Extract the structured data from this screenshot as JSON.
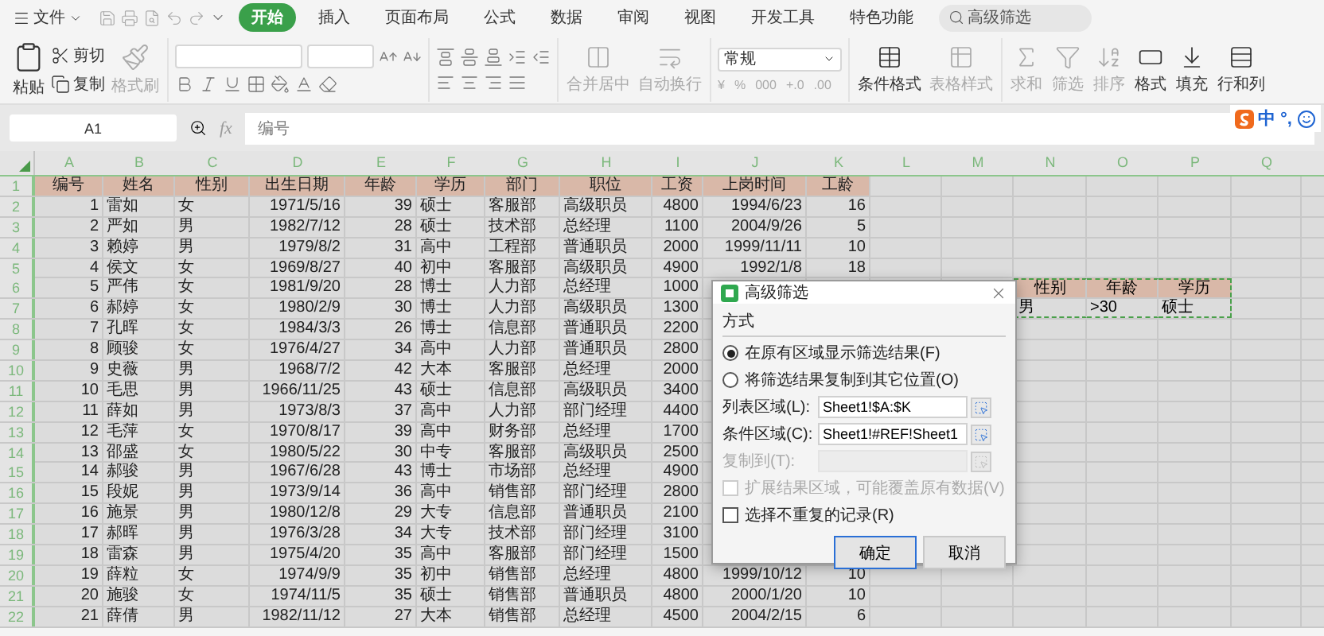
{
  "menu": {
    "file": "文件",
    "tabs": [
      {
        "label": "开始",
        "selected": true
      },
      {
        "label": "插入",
        "selected": false
      },
      {
        "label": "页面布局",
        "selected": false
      },
      {
        "label": "公式",
        "selected": false
      },
      {
        "label": "数据",
        "selected": false
      },
      {
        "label": "审阅",
        "selected": false
      },
      {
        "label": "视图",
        "selected": false
      },
      {
        "label": "开发工具",
        "selected": false
      },
      {
        "label": "特色功能",
        "selected": false
      }
    ],
    "search": {
      "placeholder": "高级筛选"
    }
  },
  "ribbon": {
    "clipboard": [
      {
        "label": "粘贴",
        "disabled": false
      },
      {
        "label": "剪切",
        "disabled": false
      },
      {
        "label": "复制",
        "disabled": false
      },
      {
        "label": "格式刷",
        "disabled": true
      }
    ],
    "merge": [
      {
        "label": "合并居中",
        "disabled": true
      },
      {
        "label": "自动换行",
        "disabled": true
      }
    ],
    "number_format": {
      "value": "常规",
      "symbols": [
        "¥",
        "%",
        "000",
        "+.0",
        ".00"
      ]
    },
    "styles": [
      {
        "label": "条件格式",
        "disabled": false
      },
      {
        "label": "表格样式",
        "disabled": true
      }
    ],
    "editing": [
      {
        "label": "求和",
        "disabled": true
      },
      {
        "label": "筛选",
        "disabled": true
      },
      {
        "label": "排序",
        "disabled": true
      },
      {
        "label": "格式",
        "disabled": false
      },
      {
        "label": "填充",
        "disabled": false
      },
      {
        "label": "行和列",
        "disabled": false
      }
    ]
  },
  "formula_bar": {
    "cell": "A1",
    "fx": "fx",
    "content": "编号"
  },
  "ime": {
    "mode": "中",
    "punct": "°,"
  },
  "columns": [
    "A",
    "B",
    "C",
    "D",
    "E",
    "F",
    "G",
    "H",
    "I",
    "J",
    "K",
    "L",
    "M",
    "N",
    "O",
    "P",
    "Q"
  ],
  "rows": [
    {
      "number": "1",
      "cells": [
        "编号",
        "姓名",
        "性别",
        "出生日期",
        "年龄",
        "学历",
        "部门",
        "职位",
        "工资",
        "上岗时间",
        "工龄"
      ]
    },
    {
      "number": "2",
      "cells": [
        "1",
        "雷如",
        "女",
        "1971/5/16",
        "39",
        "硕士",
        "客服部",
        "高级职员",
        "4800",
        "1994/6/23",
        "16"
      ]
    },
    {
      "number": "3",
      "cells": [
        "2",
        "严如",
        "男",
        "1982/7/12",
        "28",
        "硕士",
        "技术部",
        "总经理",
        "1100",
        "2004/9/26",
        "5"
      ]
    },
    {
      "number": "4",
      "cells": [
        "3",
        "赖婷",
        "男",
        "1979/8/2",
        "31",
        "高中",
        "工程部",
        "普通职员",
        "2000",
        "1999/11/11",
        "10"
      ]
    },
    {
      "number": "5",
      "cells": [
        "4",
        "侯文",
        "女",
        "1969/8/27",
        "40",
        "初中",
        "客服部",
        "高级职员",
        "4900",
        "1992/1/8",
        "18"
      ]
    },
    {
      "number": "6",
      "cells": [
        "5",
        "严伟",
        "女",
        "1981/9/20",
        "28",
        "博士",
        "人力部",
        "总经理",
        "1000",
        null,
        null
      ]
    },
    {
      "number": "7",
      "cells": [
        "6",
        "郝婷",
        "女",
        "1980/2/9",
        "30",
        "博士",
        "人力部",
        "高级职员",
        "1300",
        null,
        null
      ]
    },
    {
      "number": "8",
      "cells": [
        "7",
        "孔晖",
        "女",
        "1984/3/3",
        "26",
        "博士",
        "信息部",
        "普通职员",
        "2200",
        null,
        null
      ]
    },
    {
      "number": "9",
      "cells": [
        "8",
        "顾骏",
        "女",
        "1976/4/27",
        "34",
        "高中",
        "人力部",
        "普通职员",
        "2800",
        null,
        null
      ]
    },
    {
      "number": "10",
      "cells": [
        "9",
        "史薇",
        "男",
        "1968/7/2",
        "42",
        "大本",
        "客服部",
        "总经理",
        "2000",
        null,
        null
      ]
    },
    {
      "number": "11",
      "cells": [
        "10",
        "毛思",
        "男",
        "1966/11/25",
        "43",
        "硕士",
        "信息部",
        "高级职员",
        "3400",
        null,
        null
      ]
    },
    {
      "number": "12",
      "cells": [
        "11",
        "薛如",
        "男",
        "1973/8/3",
        "37",
        "高中",
        "人力部",
        "部门经理",
        "4400",
        null,
        null
      ]
    },
    {
      "number": "13",
      "cells": [
        "12",
        "毛萍",
        "女",
        "1970/8/17",
        "39",
        "高中",
        "财务部",
        "总经理",
        "1700",
        null,
        null
      ]
    },
    {
      "number": "14",
      "cells": [
        "13",
        "邵盛",
        "女",
        "1980/5/22",
        "30",
        "中专",
        "客服部",
        "高级职员",
        "2500",
        null,
        null
      ]
    },
    {
      "number": "15",
      "cells": [
        "14",
        "郝骏",
        "男",
        "1967/6/28",
        "43",
        "博士",
        "市场部",
        "总经理",
        "4900",
        null,
        null
      ]
    },
    {
      "number": "16",
      "cells": [
        "15",
        "段妮",
        "男",
        "1973/9/14",
        "36",
        "高中",
        "销售部",
        "部门经理",
        "2800",
        null,
        null
      ]
    },
    {
      "number": "17",
      "cells": [
        "16",
        "施景",
        "男",
        "1980/12/8",
        "29",
        "大专",
        "信息部",
        "普通职员",
        "2100",
        null,
        null
      ]
    },
    {
      "number": "18",
      "cells": [
        "17",
        "郝晖",
        "男",
        "1976/3/28",
        "34",
        "大专",
        "技术部",
        "部门经理",
        "3100",
        null,
        null
      ]
    },
    {
      "number": "19",
      "cells": [
        "18",
        "雷森",
        "男",
        "1975/4/20",
        "35",
        "高中",
        "客服部",
        "部门经理",
        "1500",
        null,
        null
      ]
    },
    {
      "number": "20",
      "cells": [
        "19",
        "薛粒",
        "女",
        "1974/9/9",
        "35",
        "初中",
        "销售部",
        "总经理",
        "4800",
        "1999/10/12",
        "10"
      ]
    },
    {
      "number": "21",
      "cells": [
        "20",
        "施骏",
        "女",
        "1974/11/5",
        "35",
        "硕士",
        "销售部",
        "普通职员",
        "4800",
        "2000/1/20",
        "10"
      ]
    },
    {
      "number": "22",
      "cells": [
        "21",
        "薛倩",
        "男",
        "1982/11/12",
        "27",
        "大本",
        "销售部",
        "总经理",
        "4500",
        "2004/2/15",
        "6"
      ]
    }
  ],
  "criteria": {
    "header": [
      "性别",
      "年龄",
      "学历"
    ],
    "values": [
      "男",
      ">30",
      "硕士"
    ]
  },
  "dialog": {
    "title": "高级筛选",
    "section": "方式",
    "options": [
      {
        "label": "在原有区域显示筛选结果(F)",
        "selected": true
      },
      {
        "label": "将筛选结果复制到其它位置(O)",
        "selected": false
      }
    ],
    "fields": [
      {
        "label": "列表区域(L):",
        "value": "Sheet1!$A:$K",
        "disabled": false
      },
      {
        "label": "条件区域(C):",
        "value": "Sheet1!#REF!Sheet1",
        "disabled": false
      },
      {
        "label": "复制到(T):",
        "disabled": true
      }
    ],
    "checkboxes": [
      {
        "label": "扩展结果区域，可能覆盖原有数据(V)",
        "checked": false,
        "disabled": true
      },
      {
        "label": "选择不重复的记录(R)",
        "checked": false,
        "disabled": false
      }
    ],
    "buttons": [
      {
        "label": "确定",
        "default": true
      },
      {
        "label": "取消",
        "default": false
      }
    ]
  }
}
